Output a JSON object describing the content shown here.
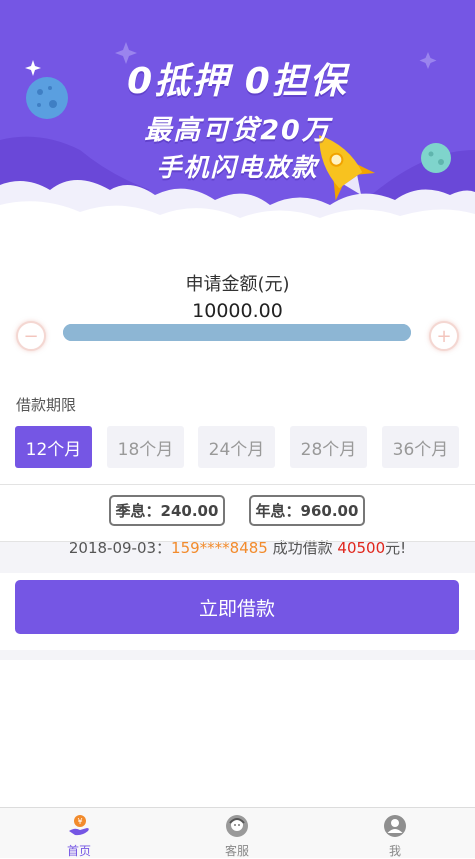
{
  "banner": {
    "line1": "0抵押 0担保",
    "line2": "最高可贷20万",
    "line3": "手机闪电放款",
    "colors": {
      "sky": "#7556e4",
      "cloud": "#ffffff",
      "rocket": "#f8c21f"
    }
  },
  "amount": {
    "title": "申请金额(元)",
    "value": "10000.00",
    "slider_progress": 1.0,
    "minus_icon": "minus-circle-icon",
    "plus_icon": "plus-circle-icon"
  },
  "period": {
    "label": "借款期限",
    "options": [
      "12个月",
      "18个月",
      "24个月",
      "28个月",
      "36个月"
    ],
    "selected": "12个月"
  },
  "interest": {
    "season": "季息：240.00",
    "year": "年息：960.00"
  },
  "ticker": {
    "date": "2018-09-03：",
    "phone": "159****8485",
    "middle": " 成功借款 ",
    "amount": "40500",
    "suffix": "元!"
  },
  "apply": {
    "label": "立即借款"
  },
  "tabbar": {
    "home": "首页",
    "service": "客服",
    "me": "我"
  },
  "colors": {
    "accent": "#7556e4",
    "phone": "#f28b2c",
    "money": "#e0261c"
  }
}
